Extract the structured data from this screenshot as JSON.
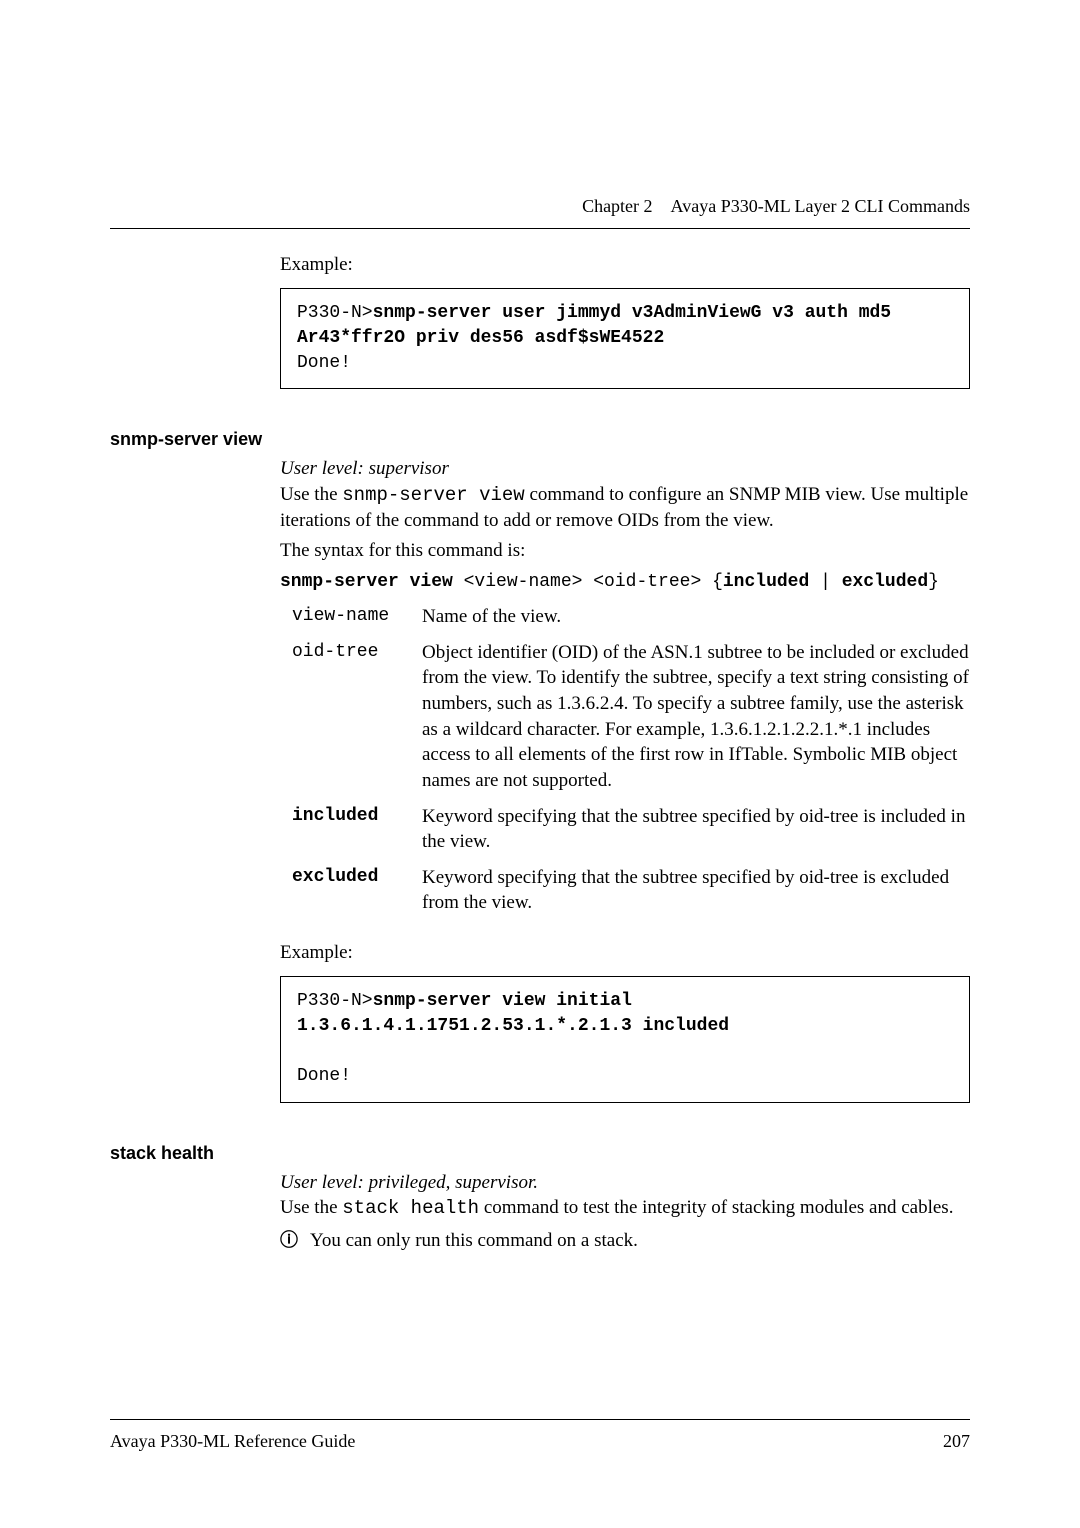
{
  "header": {
    "chapter": "Chapter 2",
    "title": "Avaya P330-ML Layer 2 CLI Commands"
  },
  "footer": {
    "left": "Avaya P330-ML Reference Guide",
    "page": "207"
  },
  "top": {
    "example_label": "Example:",
    "code_prompt": "P330-N>",
    "code_cmd": "snmp-server user jimmyd v3AdminViewG v3 auth md5 Ar43*ffr2O priv des56 asdf$sWE4522",
    "code_out": "Done!"
  },
  "snmp_view": {
    "title": "snmp-server view",
    "userlevel": "User level: supervisor",
    "p1_a": "Use the ",
    "p1_cmd": "snmp-server view",
    "p1_b": " command to configure an SNMP MIB view. Use multiple iterations of the command to add or remove OIDs from the view.",
    "p2": "The syntax for this command is:",
    "syntax_bold1": "snmp-server view",
    "syntax_plain": " <view-name> <oid-tree> {",
    "syntax_bold2": "included",
    "syntax_sep": " | ",
    "syntax_bold3": "excluded",
    "syntax_close": "}",
    "params": [
      {
        "key": "view-name",
        "bold": false,
        "desc": "Name of the view."
      },
      {
        "key": "oid-tree",
        "bold": false,
        "desc": "Object identifier (OID) of the ASN.1 subtree to be included or excluded from the view. To identify the subtree, specify a text string consisting of numbers, such as 1.3.6.2.4. To specify a subtree family, use the asterisk as a wildcard character. For example, 1.3.6.1.2.1.2.2.1.*.1 includes access to all elements of the first row in IfTable.\nSymbolic MIB object names are not supported."
      },
      {
        "key": "included",
        "bold": true,
        "desc": "Keyword specifying that the subtree specified by oid-tree is included in the view."
      },
      {
        "key": "excluded",
        "bold": true,
        "desc": "Keyword specifying that the subtree specified by oid-tree is excluded from the view."
      }
    ],
    "example_label": "Example:",
    "code_prompt": "P330-N>",
    "code_cmd": "snmp-server view initial 1.3.6.1.4.1.1751.2.53.1.*.2.1.3 included",
    "code_out": "Done!"
  },
  "stack_health": {
    "title": "stack health",
    "userlevel": "User level: privileged, supervisor.",
    "p1_a": "Use the ",
    "p1_cmd": "stack health",
    "p1_b": " command to test the integrity of stacking modules and cables.",
    "note_icon": "ⓘ",
    "note_text": "You can only run this command on a stack."
  }
}
